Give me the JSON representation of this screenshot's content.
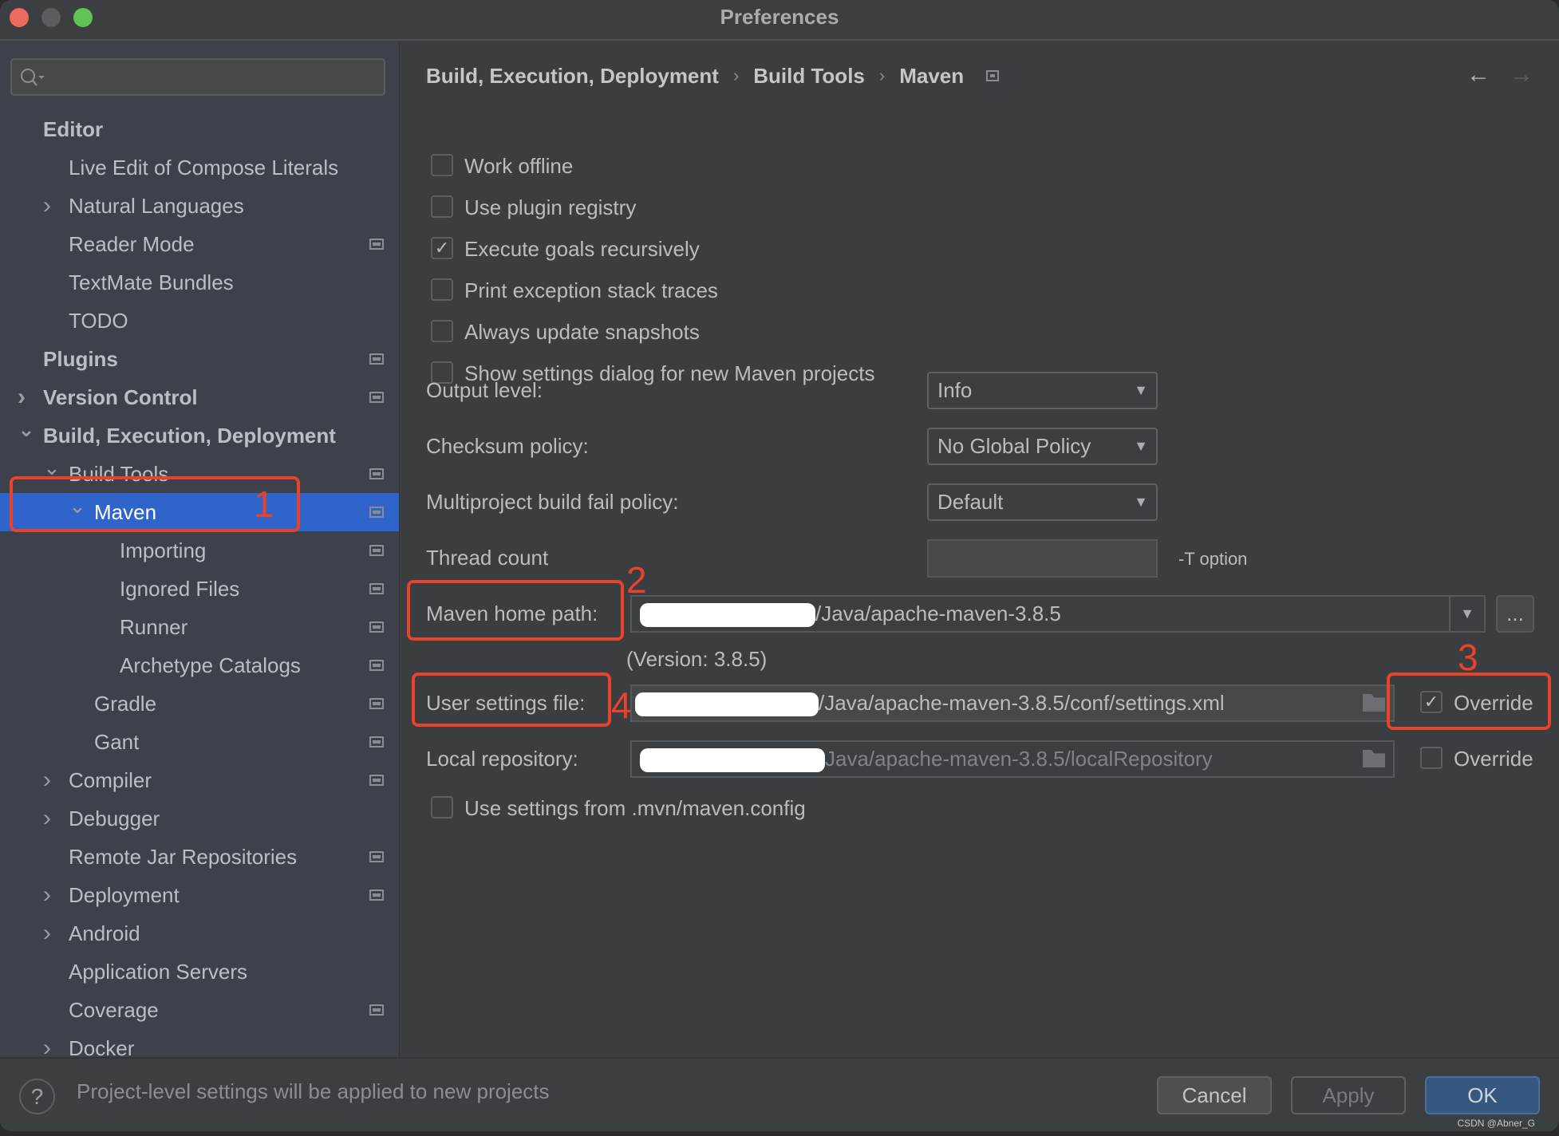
{
  "window": {
    "title": "Preferences",
    "traffic_lights": {
      "close": "#ee6a5f",
      "minimize": "#5a5c5f",
      "maximize": "#5fc454"
    }
  },
  "sidebar": {
    "search": {
      "placeholder": "",
      "icon": "search-icon"
    },
    "selection_color": "#2f65ca",
    "items": [
      {
        "label": "Editor",
        "level": 0,
        "bold": true,
        "chevron": "none",
        "project_icon": false
      },
      {
        "label": "Live Edit of Compose Literals",
        "level": 1,
        "bold": false,
        "chevron": "none",
        "project_icon": false
      },
      {
        "label": "Natural Languages",
        "level": 1,
        "bold": false,
        "chevron": "right",
        "project_icon": false
      },
      {
        "label": "Reader Mode",
        "level": 1,
        "bold": false,
        "chevron": "none",
        "project_icon": true
      },
      {
        "label": "TextMate Bundles",
        "level": 1,
        "bold": false,
        "chevron": "none",
        "project_icon": false
      },
      {
        "label": "TODO",
        "level": 1,
        "bold": false,
        "chevron": "none",
        "project_icon": false
      },
      {
        "label": "Plugins",
        "level": 0,
        "bold": true,
        "chevron": "none",
        "project_icon": true
      },
      {
        "label": "Version Control",
        "level": 0,
        "bold": true,
        "chevron": "right",
        "project_icon": true
      },
      {
        "label": "Build, Execution, Deployment",
        "level": 0,
        "bold": true,
        "chevron": "down",
        "project_icon": false
      },
      {
        "label": "Build Tools",
        "level": 1,
        "bold": false,
        "chevron": "down",
        "project_icon": true
      },
      {
        "label": "Maven",
        "level": 2,
        "bold": false,
        "chevron": "down",
        "project_icon": true,
        "selected": true
      },
      {
        "label": "Importing",
        "level": 3,
        "bold": false,
        "chevron": "none",
        "project_icon": true
      },
      {
        "label": "Ignored Files",
        "level": 3,
        "bold": false,
        "chevron": "none",
        "project_icon": true
      },
      {
        "label": "Runner",
        "level": 3,
        "bold": false,
        "chevron": "none",
        "project_icon": true
      },
      {
        "label": "Archetype Catalogs",
        "level": 3,
        "bold": false,
        "chevron": "none",
        "project_icon": true
      },
      {
        "label": "Gradle",
        "level": 2,
        "bold": false,
        "chevron": "none",
        "project_icon": true
      },
      {
        "label": "Gant",
        "level": 2,
        "bold": false,
        "chevron": "none",
        "project_icon": true
      },
      {
        "label": "Compiler",
        "level": 1,
        "bold": false,
        "chevron": "right",
        "project_icon": true
      },
      {
        "label": "Debugger",
        "level": 1,
        "bold": false,
        "chevron": "right",
        "project_icon": false
      },
      {
        "label": "Remote Jar Repositories",
        "level": 1,
        "bold": false,
        "chevron": "none",
        "project_icon": true
      },
      {
        "label": "Deployment",
        "level": 1,
        "bold": false,
        "chevron": "right",
        "project_icon": true
      },
      {
        "label": "Android",
        "level": 1,
        "bold": false,
        "chevron": "right",
        "project_icon": false
      },
      {
        "label": "Application Servers",
        "level": 1,
        "bold": false,
        "chevron": "none",
        "project_icon": false
      },
      {
        "label": "Coverage",
        "level": 1,
        "bold": false,
        "chevron": "none",
        "project_icon": true
      },
      {
        "label": "Docker",
        "level": 1,
        "bold": false,
        "chevron": "right",
        "project_icon": false
      }
    ]
  },
  "main": {
    "breadcrumb": [
      "Build, Execution, Deployment",
      "Build Tools",
      "Maven"
    ],
    "breadcrumb_separator": "›",
    "nav": {
      "back": "←",
      "forward": "→"
    },
    "checkboxes": [
      {
        "label": "Work offline",
        "checked": false
      },
      {
        "label": "Use plugin registry",
        "checked": false
      },
      {
        "label": "Execute goals recursively",
        "checked": true
      },
      {
        "label": "Print exception stack traces",
        "checked": false
      },
      {
        "label": "Always update snapshots",
        "checked": false
      },
      {
        "label": "Show settings dialog for new Maven projects",
        "checked": false
      }
    ],
    "output_level": {
      "label": "Output level:",
      "value": "Info"
    },
    "checksum_policy": {
      "label": "Checksum policy:",
      "value": "No Global Policy"
    },
    "multiproject_policy": {
      "label": "Multiproject build fail policy:",
      "value": "Default"
    },
    "thread_count": {
      "label": "Thread count",
      "value": "",
      "hint": "-T option"
    },
    "maven_home": {
      "label": "Maven home path:",
      "value": "/Java/apache-maven-3.8.5",
      "browse_label": "...",
      "version": "(Version: 3.8.5)"
    },
    "user_settings": {
      "label": "User settings file:",
      "value": "/Java/apache-maven-3.8.5/conf/settings.xml",
      "override_label": "Override",
      "override_checked": true
    },
    "local_repo": {
      "label": "Local repository:",
      "value": "Java/apache-maven-3.8.5/localRepository",
      "override_label": "Override",
      "override_checked": false
    },
    "mvn_config": {
      "label": "Use settings from .mvn/maven.config",
      "checked": false
    }
  },
  "annotations": {
    "color": "#e8412c",
    "numbers": [
      "1",
      "2",
      "3",
      "4"
    ]
  },
  "footer": {
    "help": "?",
    "message": "Project-level settings will be applied to new projects",
    "cancel": "Cancel",
    "apply": "Apply",
    "ok": "OK",
    "ok_color": "#365880",
    "watermark": "CSDN @Abner_G"
  }
}
